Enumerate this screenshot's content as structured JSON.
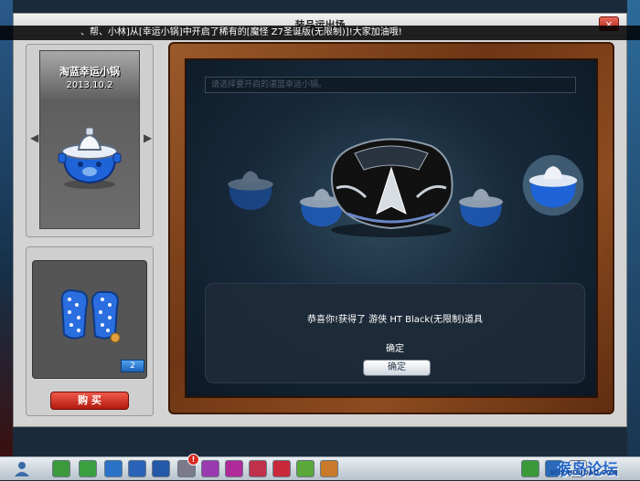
{
  "window": {
    "title": "装品运出场",
    "close_label": "×"
  },
  "marquee": {
    "text": "、帮、小林]从[幸运小锅]中开启了稀有的[魔怪 Z7圣诞版(无限制)]!大家加油哦!"
  },
  "item_panel": {
    "name": "淘蓝幸运小锅",
    "date": "2013.10.2",
    "prev_arrow": "◀",
    "next_arrow": "▶"
  },
  "reward_panel": {
    "count": "2",
    "buy_label": "购 买"
  },
  "main": {
    "select_placeholder": "请选择要开启的湛蓝幸运小锅。",
    "dialog": {
      "message": "恭喜你!获得了 游侠 HT Black(无限制)道具",
      "ok_text": "确定",
      "ok_button": "确定"
    }
  },
  "taskbar": {
    "notification_count": "!",
    "logo_text": "猴岛论坛",
    "logo_url": "BBS.HOUDAO.COM",
    "icons": [
      "user-icon",
      "back-icon",
      "shop-icon",
      "home-icon",
      "tools-icon",
      "settings-icon",
      "mail-icon",
      "friends-icon",
      "car-icon",
      "heart-icon",
      "book-icon",
      "team-icon",
      "chat-icon",
      "note-icon",
      "list-icon",
      "page-icon"
    ]
  },
  "colors": {
    "accent": "#2466c8",
    "buy": "#c8281c",
    "badge": "#2a7ad6",
    "frame": "#7a4018",
    "screen": "#17293a"
  }
}
